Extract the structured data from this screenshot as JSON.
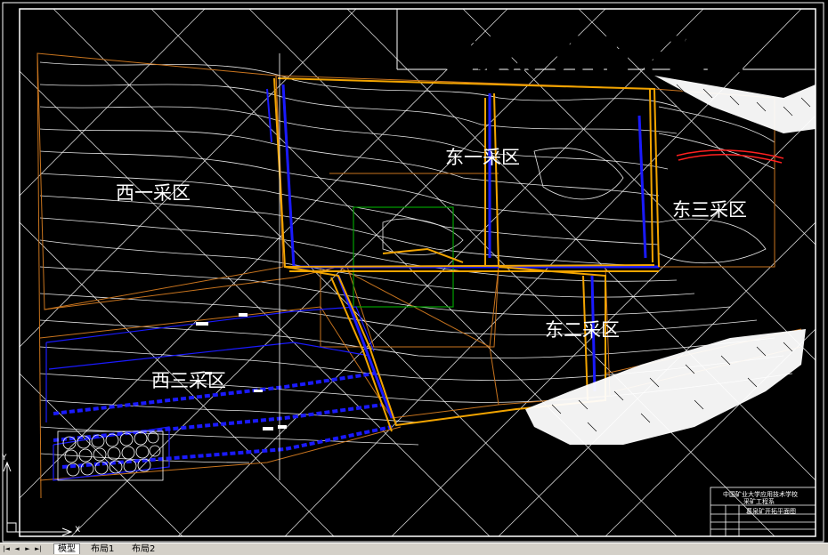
{
  "title": "葛泉矿开拓平面图",
  "zones": {
    "west_one": "西一采区",
    "east_one": "东一采区",
    "east_three": "东三采区",
    "east_two": "东二采区",
    "west_three": "西三采区"
  },
  "title_block": {
    "line1": "中国矿业大学应用技术学校",
    "line2": "采矿工程系",
    "drawing_name": "葛泉矿开拓平面图"
  },
  "ucs": {
    "x_label": "X",
    "y_label": "Y"
  },
  "tabs": [
    {
      "label": "模型",
      "active": true
    },
    {
      "label": "布局1",
      "active": false
    },
    {
      "label": "布局2",
      "active": false
    }
  ],
  "nav": {
    "first": "|◄",
    "prev": "◄",
    "next": "►",
    "last": "►|"
  },
  "colors": {
    "background": "#000000",
    "contour": "#ffffff",
    "boundary": "#c8741e",
    "roadway": "#f2a400",
    "workings": "#0000ff",
    "fault": "#ff2020",
    "grid_box": "#00a000"
  }
}
